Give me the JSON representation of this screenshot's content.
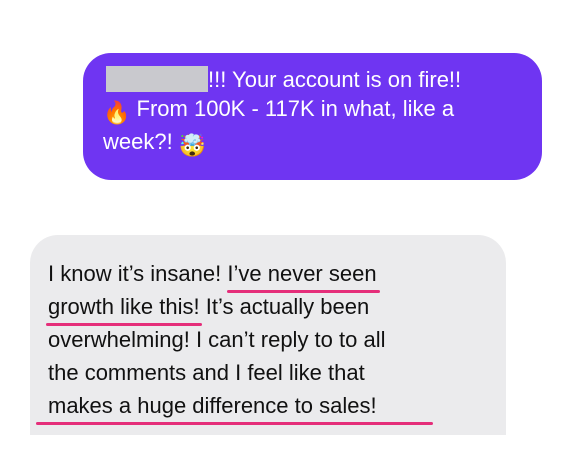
{
  "conversation": {
    "sent_message": {
      "line1_text": "!!! Your account is on fire!!",
      "line2_text": "From 100K - 117K in what, like a",
      "line3_text": "week?!",
      "emoji_fire": "🔥",
      "emoji_exploding_head": "🤯"
    },
    "received_message": {
      "line1_a": "I know it’s insane!",
      "line1_b": "I’ve never seen",
      "line2_a": "growth like this!",
      "line2_b": " It’s actually been",
      "line3": "overwhelming! I can’t reply to to all",
      "line4": "the comments and I feel like that",
      "line5": "makes a huge difference to sales!"
    },
    "colors": {
      "sent_bubble": "#6f35f2",
      "received_bubble": "#ebebed",
      "underline": "#e52e7a"
    }
  }
}
